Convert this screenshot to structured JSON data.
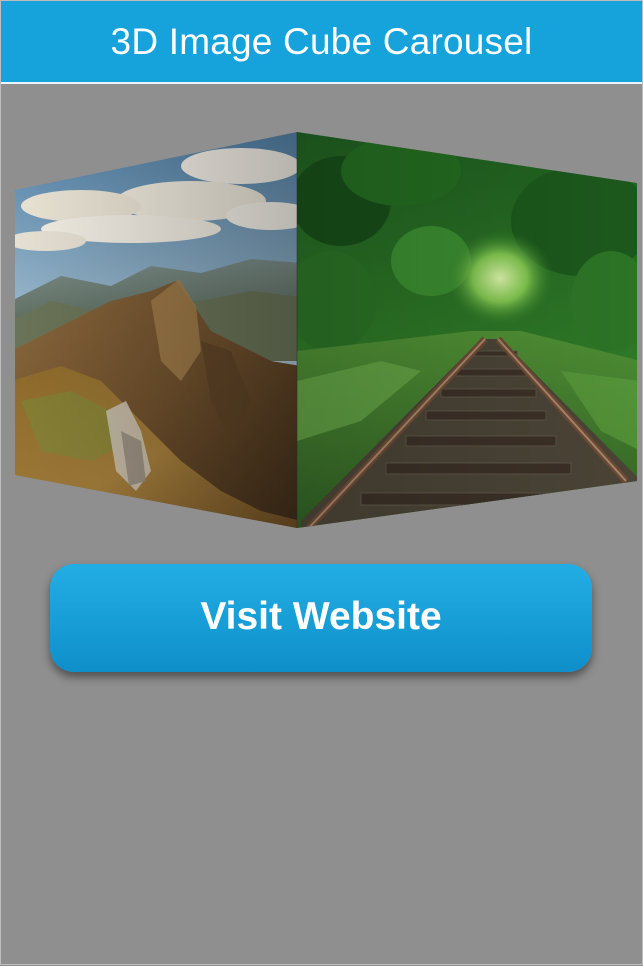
{
  "header": {
    "title": "3D Image Cube Carousel"
  },
  "carousel": {
    "faces": [
      {
        "name": "mountain-peak-landscape"
      },
      {
        "name": "forest-railway-tracks"
      }
    ]
  },
  "cta": {
    "label": "Visit Website"
  },
  "colors": {
    "header_bg": "#16a3dc",
    "button_bg": "#1aa0d8",
    "page_bg": "#8f8f8f"
  }
}
